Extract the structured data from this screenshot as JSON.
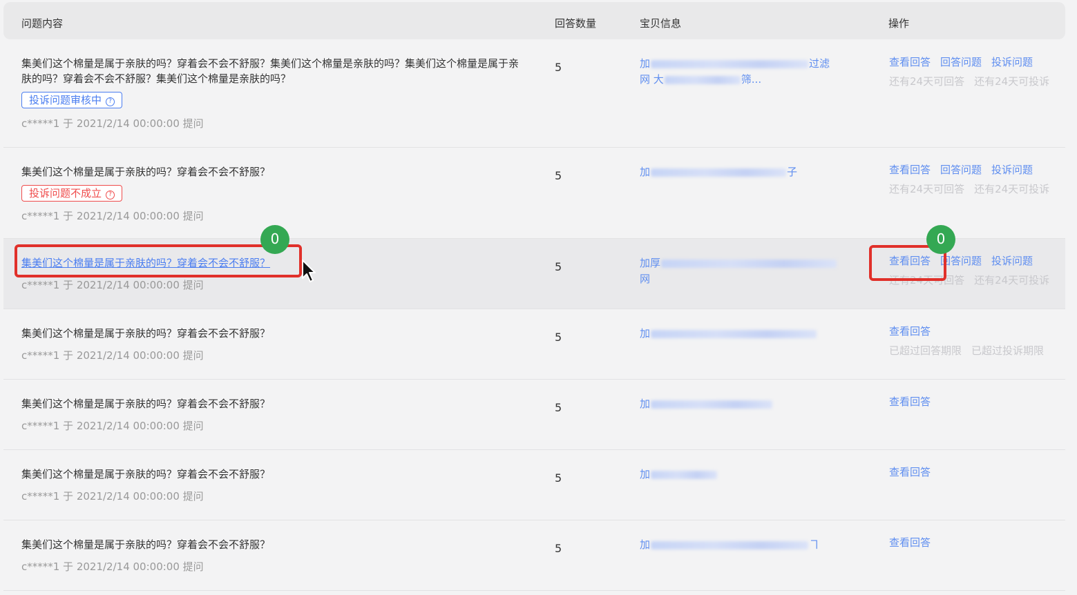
{
  "header": {
    "question_col": "问题内容",
    "count_col": "回答数量",
    "item_col": "宝贝信息",
    "ops_col": "操作"
  },
  "rows": [
    {
      "question": "集美们这个棉量是属于亲肤的吗？穿着会不会不舒服？集美们这个棉量是亲肤的吗？集美们这个棉量是属于亲肤的吗？穿着会不会不舒服？集美们这个棉量是亲肤的吗？",
      "tag": "投诉问题审核中",
      "tag_color": "#4a7df0",
      "meta": "c*****1  于 2021/2/14 00:00:00 提问",
      "count": "5",
      "item_line1_start": "加",
      "item_line1_end": "过滤",
      "item_line2_start": "网 大",
      "item_line2_end": "筛...",
      "ops": [
        "查看回答",
        "回答问题",
        "投诉问题"
      ],
      "ops_sub": [
        "还有24天可回答",
        "还有24天可投诉"
      ]
    },
    {
      "question": "集美们这个棉量是属于亲肤的吗？穿着会不会不舒服？",
      "tag": "投诉问题不成立",
      "tag_color": "#ef4b4b",
      "meta": "c*****1  于 2021/2/14 00:00:00 提问",
      "count": "5",
      "item_line1_start": "加",
      "item_line1_end": "子",
      "ops": [
        "查看回答",
        "回答问题",
        "投诉问题"
      ],
      "ops_sub": [
        "还有24天可回答",
        "还有24天可投诉"
      ]
    },
    {
      "question": "集美们这个棉量是属于亲肤的吗？穿着会不会不舒服？",
      "meta": "c*****1  于 2021/2/14 00:00:00 提问",
      "count": "5",
      "item_line1_start": "加厚",
      "item_line2_start": "网",
      "ops": [
        "查看回答",
        "回答问题",
        "投诉问题"
      ],
      "ops_sub": [
        "还有24天可回答",
        "还有24天可投诉"
      ]
    },
    {
      "question": "集美们这个棉量是属于亲肤的吗？穿着会不会不舒服？",
      "meta": "c*****1  于 2021/2/14 00:00:00 提问",
      "count": "5",
      "item_line1_start": "加",
      "ops": [
        "查看回答"
      ],
      "ops_sub": [
        "已超过回答期限",
        "已超过投诉期限"
      ]
    },
    {
      "question": "集美们这个棉量是属于亲肤的吗？穿着会不会不舒服？",
      "meta": "c*****1  于 2021/2/14 00:00:00 提问",
      "count": "5",
      "item_line1_start": "加",
      "ops": [
        "查看回答"
      ]
    },
    {
      "question": "集美们这个棉量是属于亲肤的吗？穿着会不会不舒服？",
      "meta": "c*****1  于 2021/2/14 00:00:00 提问",
      "count": "5",
      "item_line1_start": "加",
      "ops": [
        "查看回答"
      ]
    },
    {
      "question": "集美们这个棉量是属于亲肤的吗？穿着会不会不舒服？",
      "meta": "c*****1  于 2021/2/14 00:00:00 提问",
      "count": "5",
      "item_line1_start": "加",
      "item_line1_end": "ヿ",
      "ops": [
        "查看回答"
      ]
    }
  ],
  "annotations": {
    "badge_left": "0",
    "badge_right": "0"
  },
  "colors": {
    "link": "#5f8ef0",
    "highlight_box": "#e0302a",
    "badge": "#34a853"
  }
}
